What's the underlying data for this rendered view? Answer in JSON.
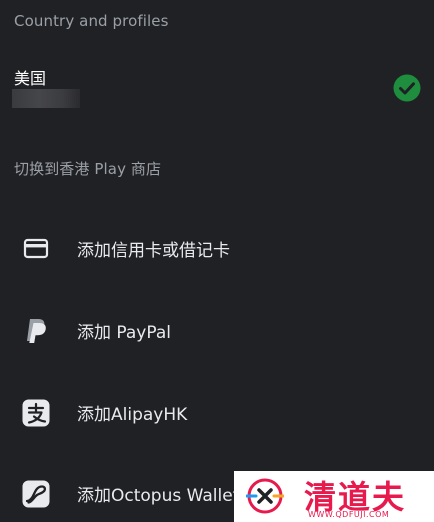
{
  "sections": {
    "country_header": "Country and profiles",
    "switch_header": "切换到香港 Play 商店"
  },
  "country": {
    "name": "美国",
    "selected": true
  },
  "payment_options": [
    {
      "icon": "credit-card-icon",
      "label": "添加信用卡或借记卡"
    },
    {
      "icon": "paypal-icon",
      "label": "添加 PayPal"
    },
    {
      "icon": "alipayhk-icon",
      "label": "添加AlipayHK"
    },
    {
      "icon": "octopus-wallet-icon",
      "label": "添加Octopus Wallet"
    }
  ],
  "watermark": {
    "text": "清道夫",
    "subtext": "WWW.QDFUJI.COM"
  },
  "colors": {
    "background": "#202124",
    "check": "#1e8e3e",
    "secondary_text": "#9aa0a6",
    "watermark": "#e8194d"
  }
}
